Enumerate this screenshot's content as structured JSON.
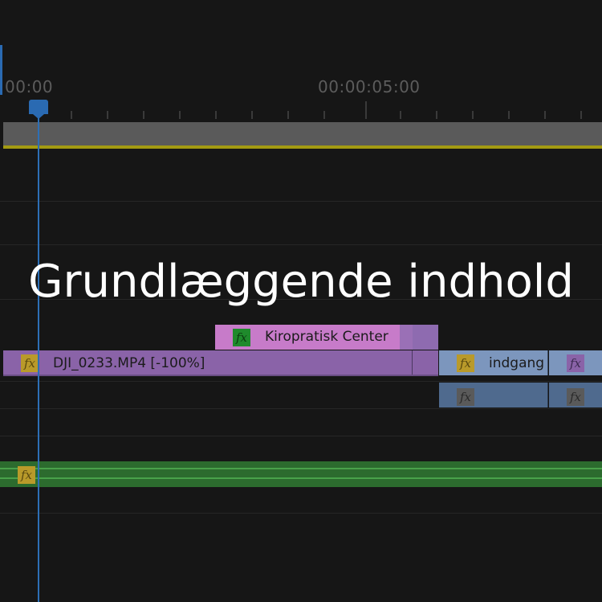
{
  "ruler": {
    "start_timecode": "00:00",
    "mid_timecode": "00:00:05:00"
  },
  "tracks": {
    "v3_clip": {
      "label": "Kiropratisk Center",
      "color": "#c77bc9"
    },
    "v2_clip_main": {
      "label": "DJI_0233.MP4 [-100%]",
      "color": "#8a63a8"
    },
    "v2_clip_right": {
      "label": "indgang",
      "color": "#7c96bd"
    },
    "v2_clip_far_right": {
      "label": "",
      "color": "#7c96bd"
    },
    "audio_clip": {
      "color": "#2c6b2e"
    },
    "fx_badge": "fx"
  },
  "overlay": {
    "title": "Grundlæggende indhold"
  },
  "colors": {
    "playhead": "#2a6ab2",
    "work_area_line": "#a39a12"
  }
}
